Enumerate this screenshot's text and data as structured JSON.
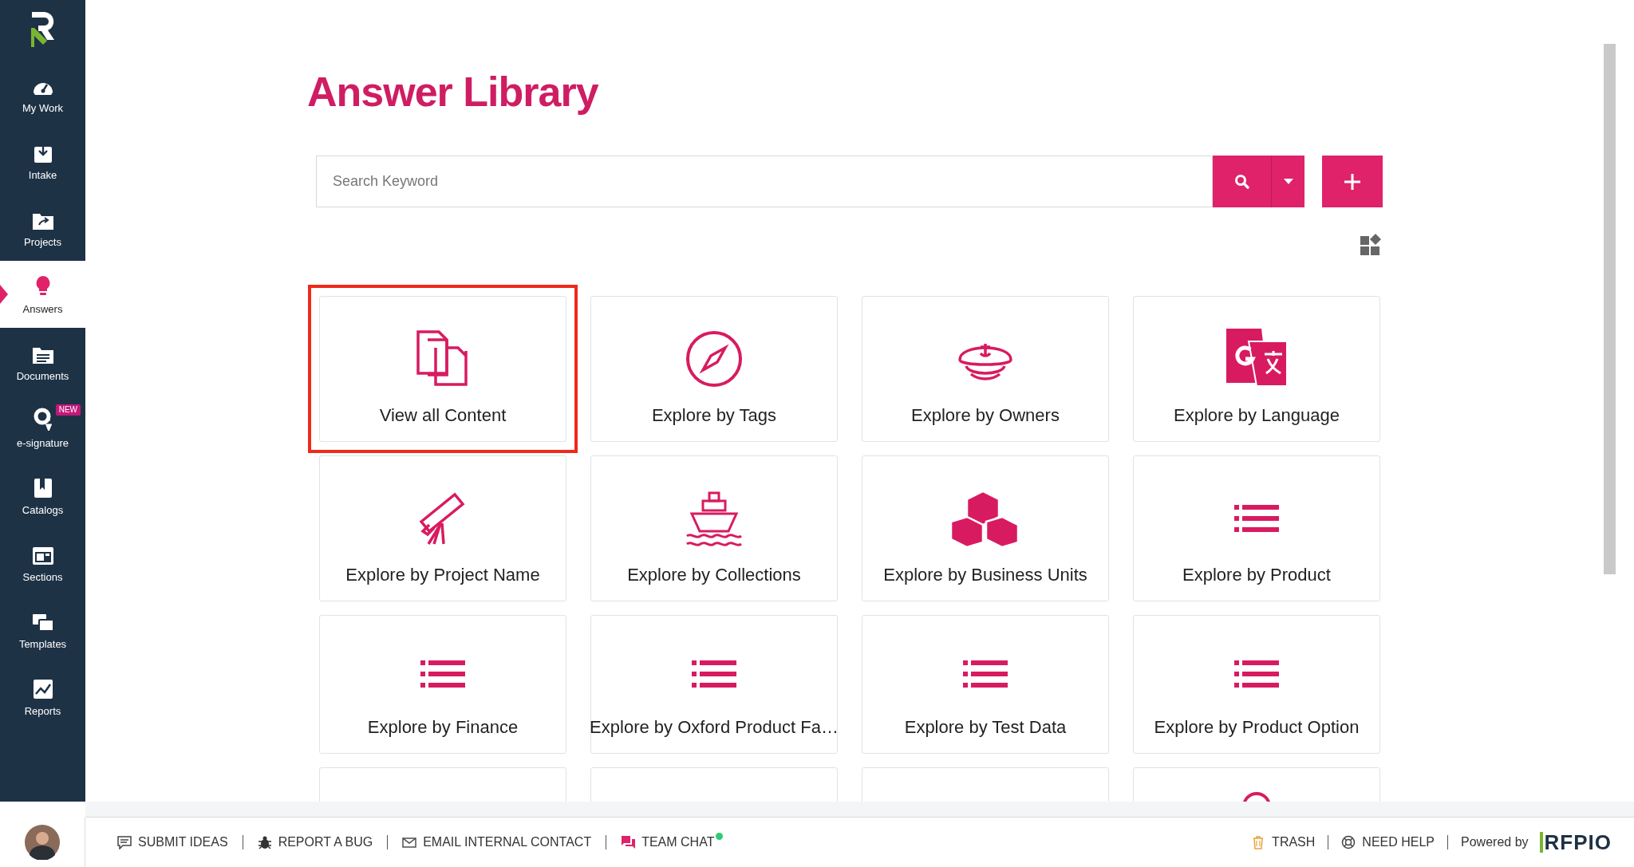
{
  "sidebar": {
    "items": [
      {
        "label": "My Work",
        "selected": false
      },
      {
        "label": "Intake",
        "selected": false
      },
      {
        "label": "Projects",
        "selected": false
      },
      {
        "label": "Answers",
        "selected": true
      },
      {
        "label": "Documents",
        "selected": false
      },
      {
        "label": "e-signature",
        "selected": false,
        "badge": "NEW"
      },
      {
        "label": "Catalogs",
        "selected": false
      },
      {
        "label": "Sections",
        "selected": false
      },
      {
        "label": "Templates",
        "selected": false
      },
      {
        "label": "Reports",
        "selected": false
      }
    ]
  },
  "page": {
    "title": "Answer Library"
  },
  "search": {
    "placeholder": "Search Keyword"
  },
  "cards": [
    {
      "label": "View all Content",
      "highlighted": true
    },
    {
      "label": "Explore by Tags",
      "highlighted": false
    },
    {
      "label": "Explore by Owners",
      "highlighted": false
    },
    {
      "label": "Explore by Language",
      "highlighted": false
    },
    {
      "label": "Explore by Project Name",
      "highlighted": false
    },
    {
      "label": "Explore by Collections",
      "highlighted": false
    },
    {
      "label": "Explore by Business Units",
      "highlighted": false
    },
    {
      "label": "Explore by Product",
      "highlighted": false
    },
    {
      "label": "Explore by Finance",
      "highlighted": false
    },
    {
      "label": "Explore by Oxford Product Fa…",
      "highlighted": false
    },
    {
      "label": "Explore by Test Data",
      "highlighted": false
    },
    {
      "label": "Explore by Product Option",
      "highlighted": false
    },
    {
      "highlighted": false
    },
    {
      "highlighted": false
    },
    {
      "highlighted": false
    },
    {
      "highlighted": false
    }
  ],
  "footer": {
    "links": [
      {
        "label": "SUBMIT IDEAS"
      },
      {
        "label": "REPORT A BUG"
      },
      {
        "label": "EMAIL INTERNAL CONTACT"
      },
      {
        "label": "TEAM CHAT",
        "online": true
      }
    ],
    "right_links": [
      {
        "label": "TRASH"
      },
      {
        "label": "NEED HELP"
      }
    ],
    "powered_by": "Powered by",
    "brand": "RFPIO"
  }
}
